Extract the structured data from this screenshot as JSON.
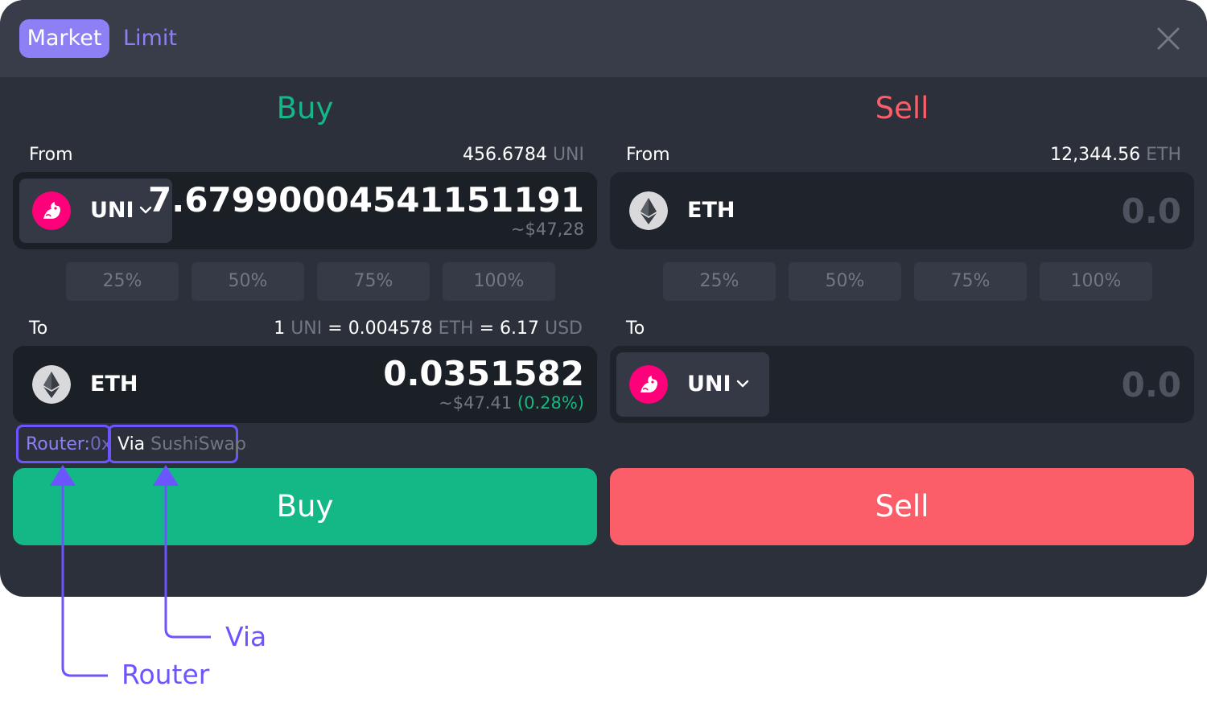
{
  "tabs": {
    "market": "Market",
    "limit": "Limit"
  },
  "buy": {
    "title": "Buy",
    "from_label": "From",
    "balance_value": "456.6784",
    "balance_unit": "UNI",
    "from_token": "UNI",
    "from_amount": "7.67990004541151191",
    "from_fiat": "~$47,28",
    "percents": [
      "25%",
      "50%",
      "75%",
      "100%"
    ],
    "to_label": "To",
    "rate": {
      "a": "1",
      "a_unit": "UNI",
      "eq1": "=",
      "b": "0.004578",
      "b_unit": "ETH",
      "eq2": "=",
      "c": "6.17",
      "c_unit": "USD"
    },
    "to_token": "ETH",
    "to_amount": "0.0351582",
    "to_fiat": "~$47.41",
    "to_change": "(0.28%)",
    "router_label": "Router:",
    "router_value": "0x",
    "via_label": "Via",
    "via_value": "SushiSwap",
    "action": "Buy"
  },
  "sell": {
    "title": "Sell",
    "from_label": "From",
    "balance_value": "12,344.56",
    "balance_unit": "ETH",
    "from_token": "ETH",
    "from_amount": "0.0",
    "percents": [
      "25%",
      "50%",
      "75%",
      "100%"
    ],
    "to_label": "To",
    "to_token": "UNI",
    "to_amount": "0.0",
    "action": "Sell"
  },
  "annotations": {
    "via": "Via",
    "router": "Router"
  },
  "icons": {
    "close": "close-icon",
    "uni": "uniswap-logo-icon",
    "eth": "ethereum-logo-icon",
    "chevron": "chevron-down-icon"
  },
  "colors": {
    "accent": "#8d80f4",
    "buy": "#13b886",
    "sell": "#fb5e68",
    "annotation": "#6c54ff",
    "uni": "#ff007a"
  }
}
